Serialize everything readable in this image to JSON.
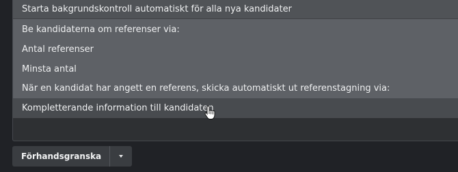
{
  "menu": {
    "items": [
      {
        "label": "Starta bakgrundskontroll automatiskt för alla nya kandidater"
      },
      {
        "label": "Be kandidaterna om referenser via:"
      },
      {
        "label": "Antal referenser"
      },
      {
        "label": "Minsta antal"
      },
      {
        "label": "När en kandidat har angett en referens, skicka automatiskt ut referenstagning via:"
      },
      {
        "label": "Kompletterande information till kandidaten"
      }
    ],
    "hovered_index": 5
  },
  "footer": {
    "preview_label": "Förhandsgranska",
    "dropdown_icon": "chevron-down-icon"
  },
  "colors": {
    "menu_bg": "#5e6166",
    "menu_top_bg": "#505357",
    "hover_bg": "#484b4f",
    "text": "#eff0f1",
    "button_bg": "#3a3d41",
    "page_bg": "#202226"
  }
}
